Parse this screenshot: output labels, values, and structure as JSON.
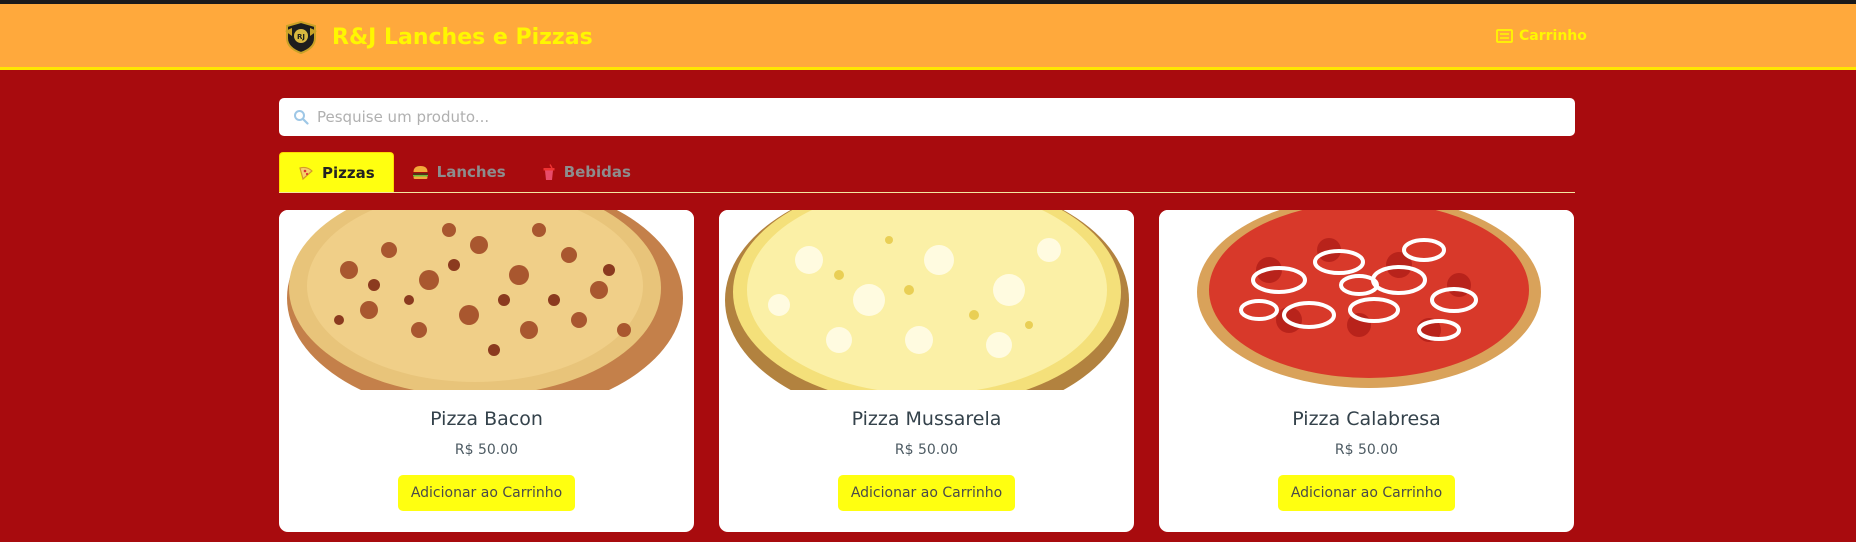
{
  "header": {
    "brand_title": "R&J Lanches e Pizzas",
    "cart_label": "Carrinho"
  },
  "search": {
    "placeholder": "Pesquise um produto...",
    "value": ""
  },
  "tabs": [
    {
      "label": "Pizzas",
      "icon": "pizza-icon",
      "active": true
    },
    {
      "label": "Lanches",
      "icon": "burger-icon",
      "active": false
    },
    {
      "label": "Bebidas",
      "icon": "drink-icon",
      "active": false
    }
  ],
  "products": [
    {
      "name": "Pizza Bacon",
      "price": "R$ 50.00",
      "button_label": "Adicionar ao Carrinho",
      "image": "pizza-bacon-image"
    },
    {
      "name": "Pizza Mussarela",
      "price": "R$ 50.00",
      "button_label": "Adicionar ao Carrinho",
      "image": "pizza-mussarela-image"
    },
    {
      "name": "Pizza Calabresa",
      "price": "R$ 50.00",
      "button_label": "Adicionar ao Carrinho",
      "image": "pizza-calabresa-image"
    }
  ],
  "colors": {
    "background": "#a80b0e",
    "header": "#ffa93c",
    "accent_yellow": "#ffff10",
    "brand_text": "#fff700"
  }
}
